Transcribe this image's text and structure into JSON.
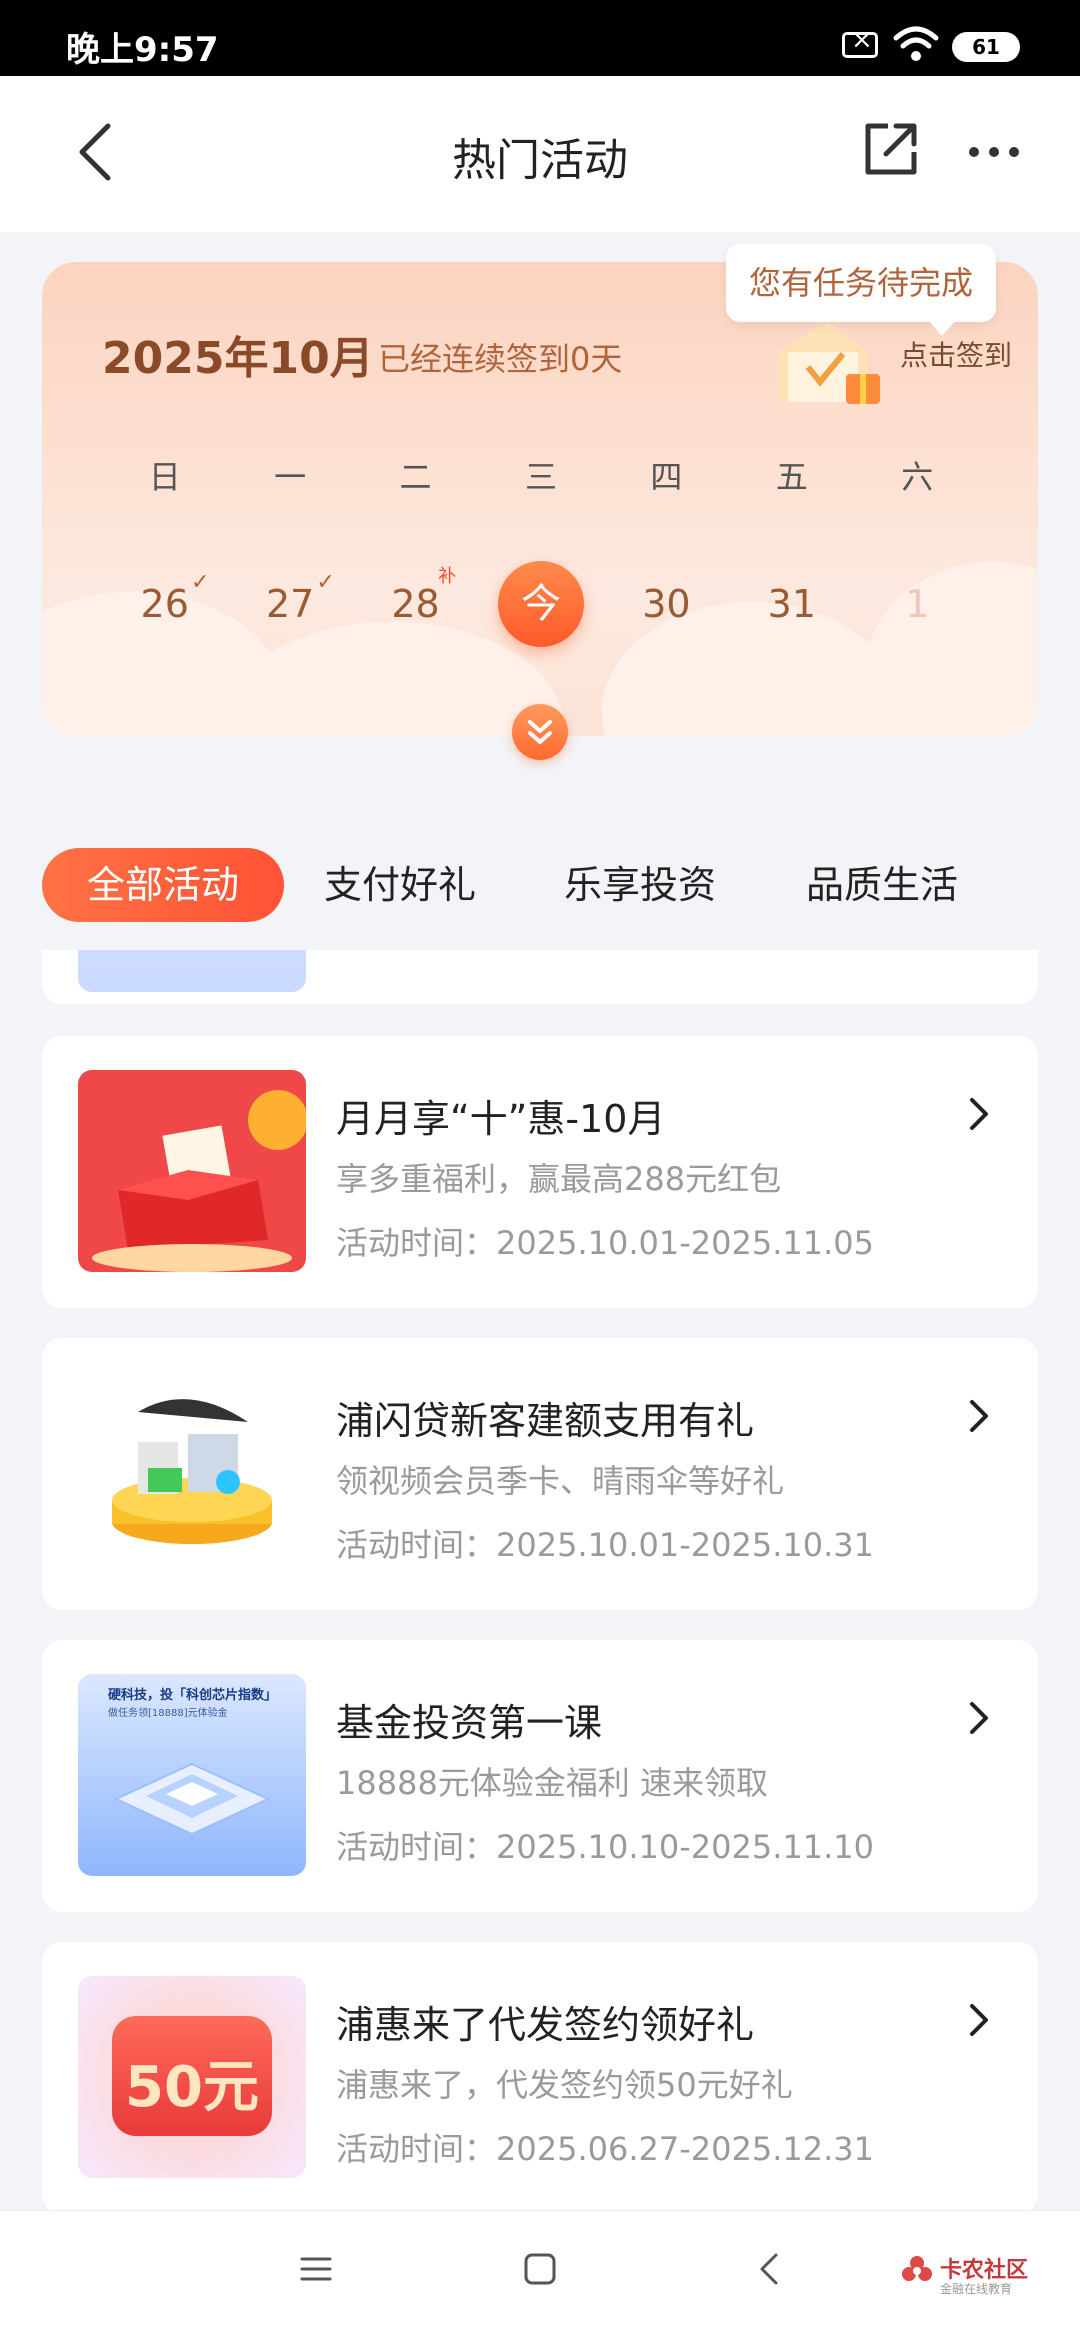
{
  "status_bar": {
    "time": "晚上9:57",
    "battery": "61"
  },
  "header": {
    "title": "热门活动"
  },
  "calendar": {
    "month": "2025年10月",
    "streak": "已经连续签到0天",
    "signin_label": "点击签到",
    "tooltip": "您有任务待完成",
    "weekdays": [
      "日",
      "一",
      "二",
      "三",
      "四",
      "五",
      "六"
    ],
    "dates": [
      "26",
      "27",
      "28",
      "今",
      "30",
      "31",
      "1"
    ],
    "makeup_mark": "补"
  },
  "tabs": [
    "全部活动",
    "支付好礼",
    "乐享投资",
    "品质生活"
  ],
  "activities": [
    {
      "title": "月月享“十”惠-10月",
      "desc": "享多重福利，赢最高288元红包",
      "date": "活动时间：2025.10.01-2025.11.05"
    },
    {
      "title": "浦闪贷新客建额支用有礼",
      "desc": "领视频会员季卡、晴雨伞等好礼",
      "date": "活动时间：2025.10.01-2025.10.31"
    },
    {
      "title": "基金投资第一课",
      "desc": "18888元体验金福利 速来领取",
      "date": "活动时间：2025.10.10-2025.11.10",
      "thumb_line1": "硬科技，投「科创芯片指数」",
      "thumb_line2": "做任务领[18888]元体验金"
    },
    {
      "title": "浦惠来了代发签约领好礼",
      "desc": "浦惠来了，代发签约领50元好礼",
      "date": "活动时间：2025.06.27-2025.12.31",
      "thumb_badge": "50元"
    }
  ],
  "watermark": {
    "text": "卡农社区",
    "sub": "金融在线教育"
  },
  "colors": {
    "accent": "#ff5a2a",
    "tab_active": "#ff5236",
    "text_muted": "#9a9a9a"
  }
}
